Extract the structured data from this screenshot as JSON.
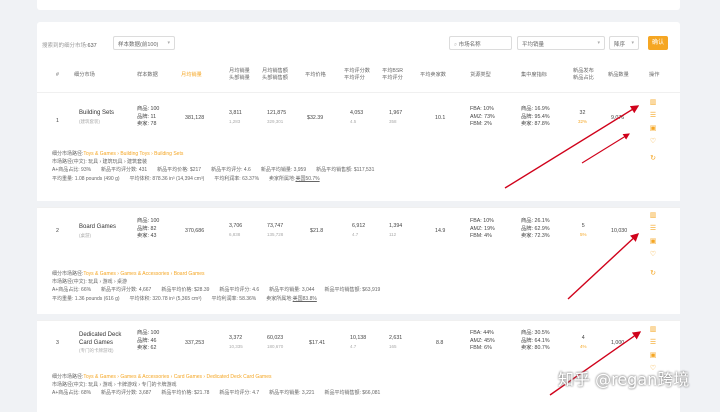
{
  "toolbar": {
    "count_label": "搜索到的细分市场:",
    "count_value": "637",
    "dropdown1": "样本数据(前100)",
    "search_placeholder": "市场名称",
    "dropdown2": "平均销量",
    "dropdown3": "降序",
    "confirm_label": "确认"
  },
  "columns": {
    "num": "#",
    "market": "细分市场",
    "sample": "样本数据",
    "avg_sales": "月均销量",
    "mo_sales": [
      "月均销量",
      "头部销量"
    ],
    "mo_revenue": [
      "月均销售额",
      "头部销售额"
    ],
    "avg_price": "平均价格",
    "avg_reviews": [
      "平均评分数",
      "平均评分"
    ],
    "avg_bsr": [
      "平均BSR",
      "平均评分"
    ],
    "avg_sellers": "平均卖家数",
    "fulfillment": "货源类型",
    "concentration": "集中度指标",
    "new_launch": [
      "新品发布",
      "新品占比"
    ],
    "launch_count": "新品数量",
    "action": "操作"
  },
  "rows": [
    {
      "idx": "1",
      "name": [
        "Building Sets",
        "(建筑套装)"
      ],
      "sample": [
        "商品: 100",
        "品牌: 11",
        "卖家: 78"
      ],
      "avg_sales": "381,128",
      "mo_sales": [
        "3,811",
        "1,283"
      ],
      "mo_revenue": [
        "121,875",
        "329,301"
      ],
      "avg_price": "$32.39",
      "avg_reviews": [
        "4,053",
        "4.5"
      ],
      "avg_bsr": [
        "1,967",
        "358"
      ],
      "avg_sellers": "10.1",
      "fulfillment": [
        "FBA: 10%",
        "AMZ: 73%",
        "FBM: 2%"
      ],
      "concentration": [
        "商品: 16.9%",
        "品牌: 95.4%",
        "卖家: 87.8%"
      ],
      "new_launch": [
        "32",
        "32%"
      ],
      "launch_count": "9,076",
      "path_label": "细分市场路径:",
      "path": "Toys & Games › Building Toys › Building Sets",
      "path_cn": "市场路径(中文): 玩具 › 建筑玩具 › 建筑套装",
      "stats1": [
        "A+商品占比: 93%",
        "新品平均评分数: 431",
        "新品平均价格: $217",
        "新品平均评分: 4.6",
        "新品平均销量: 3,959",
        "新品平均销售额: $117,531"
      ],
      "stats2": [
        "平均重量: 1.08 pounds (490 g)",
        "平均体积: 878.36 in³ (14,394 cm³)",
        "平均利润率: 63.37%",
        "卖家所属地:"
      ],
      "seller_loc": "美国50.7%"
    },
    {
      "idx": "2",
      "name": [
        "Board Games",
        "(桌游)"
      ],
      "sample": [
        "商品: 100",
        "品牌: 82",
        "卖家: 43"
      ],
      "avg_sales": "370,686",
      "mo_sales": [
        "3,706",
        "6,838"
      ],
      "mo_revenue": [
        "73,747",
        "135,728"
      ],
      "avg_price": "$21.8",
      "avg_reviews": [
        "6,912",
        "4.7"
      ],
      "avg_bsr": [
        "1,394",
        "112"
      ],
      "avg_sellers": "14.9",
      "fulfillment": [
        "FBA: 10%",
        "AMZ: 19%",
        "FBM: 4%"
      ],
      "concentration": [
        "商品: 26.1%",
        "品牌: 62.9%",
        "卖家: 72.3%"
      ],
      "new_launch": [
        "5",
        "5%"
      ],
      "launch_count": "10,030",
      "path_label": "细分市场路径:",
      "path": "Toys & Games › Games & Accessories › Board Games",
      "path_cn": "市场路径(中文): 玩具 › 游戏 › 桌游",
      "stats1": [
        "A+商品占比: 66%",
        "新品平均评分数: 4,667",
        "新品平均价格: $28.39",
        "新品平均评分: 4.6",
        "新品平均销量: 3,044",
        "新品平均销售额: $63,919"
      ],
      "stats2": [
        "平均重量: 1.36 pounds (616 g)",
        "平均体积: 320.78 in³ (5,365 cm³)",
        "平均利润率: 58.36%",
        "卖家所属地:"
      ],
      "seller_loc": "美国83.8%"
    },
    {
      "idx": "3",
      "name": [
        "Dedicated Deck",
        "Card Games",
        "(专门的卡牌游戏)"
      ],
      "sample": [
        "商品: 100",
        "品牌: 46",
        "卖家: 62"
      ],
      "avg_sales": "337,253",
      "mo_sales": [
        "3,372",
        "10,335"
      ],
      "mo_revenue": [
        "60,023",
        "180,670"
      ],
      "avg_price": "$17.41",
      "avg_reviews": [
        "10,138",
        "4.7"
      ],
      "avg_bsr": [
        "2,631",
        "165"
      ],
      "avg_sellers": "8.8",
      "fulfillment": [
        "FBA: 44%",
        "AMZ: 45%",
        "FBM: 6%"
      ],
      "concentration": [
        "商品: 30.5%",
        "品牌: 64.1%",
        "卖家: 80.7%"
      ],
      "new_launch": [
        "4",
        "4%"
      ],
      "launch_count": "1,000",
      "path_label": "细分市场路径:",
      "path": "Toys & Games › Games & Accessories › Card Games › Dedicated Deck Card Games",
      "path_cn": "市场路径(中文): 玩具 › 游戏 › 卡牌游戏 › 专门的卡牌游戏",
      "stats1": [
        "A+商品占比: 68%",
        "新品平均评分数: 3,687",
        "新品平均价格: $21.78",
        "新品平均评分: 4.7",
        "新品平均销量: 3,221",
        "新品平均销售额: $66,081"
      ]
    }
  ],
  "icons": [
    "chart-icon",
    "list-icon",
    "export-icon",
    "favorite-icon",
    "refresh-icon"
  ],
  "colors": {
    "accent": "#f5a623",
    "arrow": "#d0021b"
  },
  "watermark": "知乎 @regan跨境"
}
